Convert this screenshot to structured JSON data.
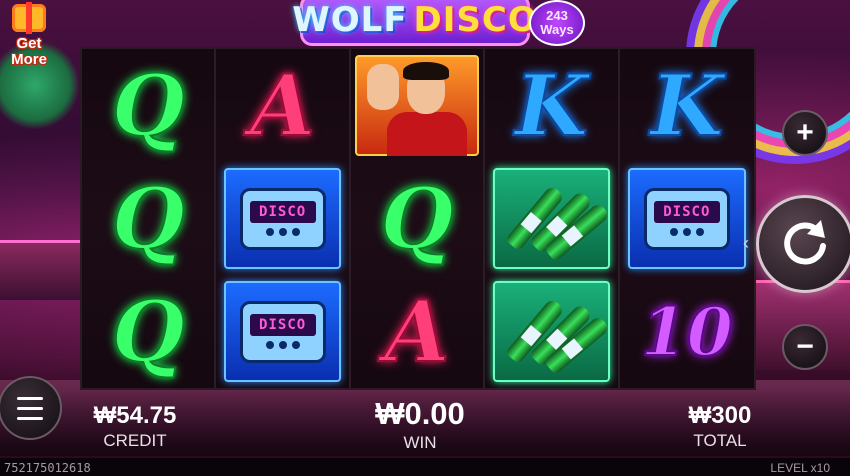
{
  "game": {
    "title_part1": "WOLF",
    "title_part2": "DISCO",
    "ways_number": "243",
    "ways_label": "Ways"
  },
  "get_more": {
    "line1": "Get",
    "line2": "More"
  },
  "reels": [
    [
      "Q",
      "Q",
      "Q"
    ],
    [
      "A",
      "pager",
      "pager"
    ],
    [
      "man",
      "Q",
      "A"
    ],
    [
      "K",
      "bottles",
      "bottles"
    ],
    [
      "K",
      "pager",
      "10"
    ]
  ],
  "symbols": {
    "pager_screen": "DISCO"
  },
  "controls": {
    "plus": "+",
    "minus": "−",
    "spin_hint": "‹"
  },
  "stats": {
    "credit_value": "₩54.75",
    "credit_label": "CREDIT",
    "win_value": "₩0.00",
    "win_label": "WIN",
    "total_value": "₩300",
    "total_label": "TOTAL"
  },
  "footer": {
    "session_id": "752175012618",
    "level": "LEVEL x10"
  },
  "colors": {
    "q": "#39ff6a",
    "a": "#ff3f7a",
    "k": "#2fa8ff",
    "ten": "#d35bff"
  }
}
